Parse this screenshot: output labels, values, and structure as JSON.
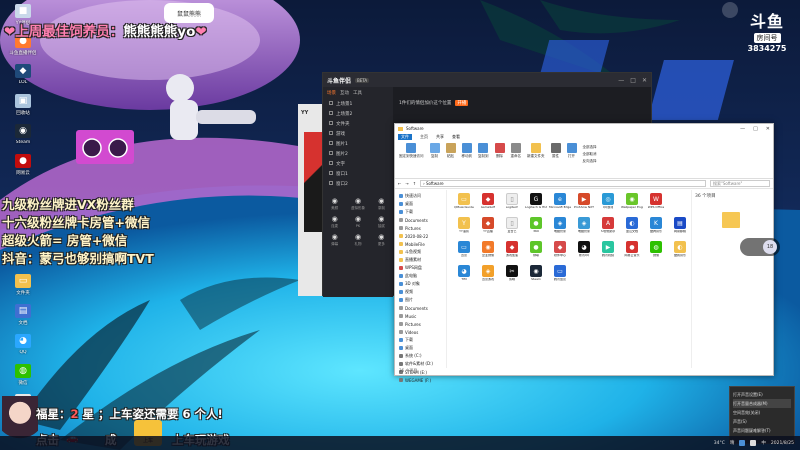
{
  "overlay": {
    "fan_title_prefix": "❤上周最佳饲养员：",
    "fan_title_name": "熊熊熊熊yo",
    "fan_title_suffix": "❤",
    "rules": [
      "九级粉丝牌进VX粉丝群",
      "十六级粉丝牌卡房管+微信",
      "超级火箭= 房管+微信",
      "抖音：蒙弓也够别搞啊TVT"
    ],
    "welfare_prefix": "福星：",
    "welfare_num": "2",
    "welfare_unit": "星",
    "welfare_suffix": "；上车姿还需要 6 个人!",
    "click_ticket": "点击",
    "ticket_suffix": "成",
    "play_game": "上车玩游戏",
    "cat_badge": "鼠鼠熊熊"
  },
  "douyu": {
    "brand": "斗鱼",
    "room_label": "房间号",
    "room_id": "3834275"
  },
  "desktop_icons": [
    {
      "label": "YY伴侣",
      "color": "#c9d8ea",
      "glyph": "■"
    },
    {
      "label": "斗鱼直播伴侣",
      "color": "#ff7a2f",
      "glyph": "●"
    },
    {
      "label": "LOL",
      "color": "#1f4a7a",
      "glyph": "◆"
    },
    {
      "label": "回收站",
      "color": "#aac4dd",
      "glyph": "▣"
    },
    {
      "label": "Steam",
      "color": "#1b2838",
      "glyph": "◉"
    },
    {
      "label": "网易云",
      "color": "#c20c0c",
      "glyph": "●"
    },
    {
      "label": "文件夹",
      "color": "#f2c14e",
      "glyph": "▭"
    },
    {
      "label": "文档",
      "color": "#3f6fd1",
      "glyph": "▤"
    },
    {
      "label": "QQ",
      "color": "#2aa7ff",
      "glyph": "◕"
    },
    {
      "label": "微信",
      "color": "#2dc100",
      "glyph": "◍"
    },
    {
      "label": "文件",
      "color": "#e8e8e8",
      "glyph": "▯"
    },
    {
      "label": "CF",
      "color": "#7a4d2a",
      "glyph": "◆"
    },
    {
      "label": "设置",
      "color": "#777",
      "glyph": "⚙"
    },
    {
      "label": "游戏",
      "color": "#2a6ac6",
      "glyph": "◆"
    }
  ],
  "stream_app": {
    "title": "斗鱼伴侣",
    "beta": "BETA",
    "tabs": [
      "场景",
      "互动",
      "工具"
    ],
    "scenes": [
      "上场景1",
      "上场景2",
      "文件夹",
      "游戏",
      "图片1",
      "图片2",
      "文字",
      "窗口1",
      "窗口2"
    ],
    "tools": [
      "美颜",
      "虚拟形象",
      "录制",
      "连麦",
      "PK",
      "抽奖",
      "弹幕",
      "礼物",
      "更多"
    ],
    "live_msg": "1件们的情侣加价这个位置",
    "live_badge": "开播",
    "ad_label": "YY"
  },
  "explorer": {
    "title": "Software",
    "menu": [
      "文件",
      "主页",
      "共享",
      "查看"
    ],
    "ribbon": [
      {
        "label": "固定到快速访问",
        "color": "#4a8fd6"
      },
      {
        "label": "复制",
        "color": "#6aa8e6"
      },
      {
        "label": "粘贴",
        "color": "#c9a35a"
      },
      {
        "label": "移动到",
        "color": "#4a8fd6"
      },
      {
        "label": "复制到",
        "color": "#4a8fd6"
      },
      {
        "label": "删除",
        "color": "#d64a4a"
      },
      {
        "label": "重命名",
        "color": "#8a8a8a"
      },
      {
        "label": "新建文件夹",
        "color": "#f2c14e"
      },
      {
        "label": "属性",
        "color": "#6a6a6a"
      },
      {
        "label": "打开",
        "color": "#4a8fd6"
      }
    ],
    "ribbon_small": [
      "全部选择",
      "全部取消",
      "反向选择"
    ],
    "address": "› Software",
    "search_placeholder": "搜索\"Software\"",
    "nav": [
      {
        "label": "快速访问",
        "color": "#4a8fd6"
      },
      {
        "label": "桌面",
        "color": "#4a8fd6"
      },
      {
        "label": "下载",
        "color": "#4a8fd6"
      },
      {
        "label": "Documents",
        "color": "#999"
      },
      {
        "label": "Pictures",
        "color": "#999"
      },
      {
        "label": "2020-08-22",
        "color": "#f2c14e"
      },
      {
        "label": "MobileFile",
        "color": "#f2c14e"
      },
      {
        "label": "斗鱼视频",
        "color": "#f2c14e"
      },
      {
        "label": "直播素材",
        "color": "#f2c14e"
      },
      {
        "label": "WPS网盘",
        "color": "#d64a4a"
      },
      {
        "label": "此电脑",
        "color": "#4a8fd6"
      },
      {
        "label": "3D 对象",
        "color": "#4a8fd6"
      },
      {
        "label": "视频",
        "color": "#4a8fd6"
      },
      {
        "label": "图片",
        "color": "#4a8fd6"
      },
      {
        "label": "Documents",
        "color": "#999"
      },
      {
        "label": "Music",
        "color": "#999"
      },
      {
        "label": "Pictures",
        "color": "#999"
      },
      {
        "label": "Videos",
        "color": "#999"
      },
      {
        "label": "下载",
        "color": "#4a8fd6"
      },
      {
        "label": "桌面",
        "color": "#4a8fd6"
      },
      {
        "label": "系统 (C:)",
        "color": "#777"
      },
      {
        "label": "软件&素材 (D:)",
        "color": "#777"
      },
      {
        "label": "STEAM (E:)",
        "color": "#777"
      },
      {
        "label": "WEGAME (F:)",
        "color": "#777"
      }
    ],
    "files": [
      {
        "label": "QMusicGuide",
        "color": "#f2c14e",
        "glyph": "▭"
      },
      {
        "label": "GameSoft",
        "color": "#d6322f",
        "glyph": "◆"
      },
      {
        "label": "Logitech",
        "color": "#eee",
        "glyph": "▯"
      },
      {
        "label": "Logitech G HUB",
        "color": "#111",
        "glyph": "G"
      },
      {
        "label": "Microsoft Edge",
        "color": "#2a87d6",
        "glyph": "e"
      },
      {
        "label": "ProShow NXT",
        "color": "#d64a2a",
        "glyph": "▶"
      },
      {
        "label": "QQ游戏",
        "color": "#2a9ad6",
        "glyph": "◎"
      },
      {
        "label": "Wallpaper Engine",
        "color": "#6ac62a",
        "glyph": "◉"
      },
      {
        "label": "WPS Office",
        "color": "#d6322f",
        "glyph": "W"
      },
      {
        "label": "",
        "color": "#fff",
        "glyph": ""
      },
      {
        "label": "YY语音",
        "color": "#f2c14e",
        "glyph": "Y"
      },
      {
        "label": "YY直播",
        "color": "#d64a2a",
        "glyph": "◆"
      },
      {
        "label": "爱奇艺",
        "color": "#eee",
        "glyph": "▯"
      },
      {
        "label": "360",
        "color": "#5ec62a",
        "glyph": "●"
      },
      {
        "label": "电脑管家",
        "color": "#2a87d6",
        "glyph": "◈"
      },
      {
        "label": "电脑管家",
        "color": "#3a9ad6",
        "glyph": "◈"
      },
      {
        "label": "AI智能助手",
        "color": "#d63a3a",
        "glyph": "A"
      },
      {
        "label": "金山文档",
        "color": "#2a6ad6",
        "glyph": "◐"
      },
      {
        "label": "酷狗音乐",
        "color": "#2a87d6",
        "glyph": "K"
      },
      {
        "label": "网易邮箱",
        "color": "#1a4ac6",
        "glyph": "▤"
      },
      {
        "label": "迅雷",
        "color": "#2a87d6",
        "glyph": "▭"
      },
      {
        "label": "企业微信",
        "color": "#f27a2a",
        "glyph": "◉"
      },
      {
        "label": "游戏加速",
        "color": "#d6322f",
        "glyph": "◆"
      },
      {
        "label": "绿联",
        "color": "#5ec62a",
        "glyph": "●"
      },
      {
        "label": "软件中心",
        "color": "#d64a4a",
        "glyph": "◆"
      },
      {
        "label": "腾讯QQ",
        "color": "#111",
        "glyph": "◕"
      },
      {
        "label": "腾讯视频",
        "color": "#2ac6a0",
        "glyph": "▶"
      },
      {
        "label": "网易云音乐",
        "color": "#d6322f",
        "glyph": "●"
      },
      {
        "label": "微信",
        "color": "#2dc100",
        "glyph": "◍"
      },
      {
        "label": "酷我音乐",
        "color": "#f2c14e",
        "glyph": "◐"
      },
      {
        "label": "TIM",
        "color": "#2a87d6",
        "glyph": "◕"
      },
      {
        "label": "迅雷游戏",
        "color": "#f2a02a",
        "glyph": "◈"
      },
      {
        "label": "剪映",
        "color": "#111",
        "glyph": "✂"
      },
      {
        "label": "Steam",
        "color": "#1b2838",
        "glyph": "◉"
      },
      {
        "label": "腾讯会议",
        "color": "#2a6ad6",
        "glyph": "▭"
      }
    ],
    "item_count": "36 个项目",
    "status": "36 个项目"
  },
  "context_menu": [
    "打开声音设置(E)",
    "打开音量合成器(M)",
    "空间音效(关闭)",
    "声音(S)",
    "声音问题疑难解答(T)"
  ],
  "tray": {
    "temp": "34°C",
    "weather": "晴",
    "lang": "中",
    "time": "2021/8/25"
  },
  "side_badge": "18"
}
